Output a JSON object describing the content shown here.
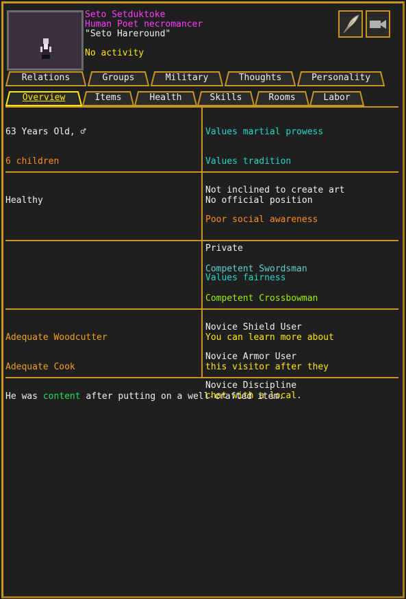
{
  "unit": {
    "name": "Seto Setduktoke",
    "profession": "Human Poet necromancer",
    "nickname": "\"Seto Hareround\"",
    "activity": "No activity"
  },
  "icons": {
    "quill": "quill-icon",
    "camera": "camera-icon"
  },
  "tabs_top": [
    "Relations",
    "Groups",
    "Military",
    "Thoughts",
    "Personality"
  ],
  "tabs_bottom": [
    "Overview",
    "Items",
    "Health",
    "Skills",
    "Rooms",
    "Labor"
  ],
  "active_tab": "Overview",
  "overview": {
    "age": "63 Years Old, ♂",
    "children": "6 children",
    "values": [
      {
        "text": "Values martial prowess",
        "color": "#22d8c8"
      },
      {
        "text": "Values tradition",
        "color": "#22d8c8"
      },
      {
        "text": "Not inclined to create art",
        "color": "#f0f0f0"
      },
      {
        "text": "Poor social awareness",
        "color": "#ff8c1e"
      },
      {
        "text": "Private",
        "color": "#f0f0f0"
      },
      {
        "text": "Values fairness",
        "color": "#22d8c8"
      }
    ],
    "health": "Healthy",
    "position": "No official position",
    "military_skills": [
      {
        "text": "Competent Swordsman",
        "color": "#60d0d0"
      },
      {
        "text": "Competent Crossbowman",
        "color": "#9cf000"
      },
      {
        "text": "Novice Shield User",
        "color": "#f0f0f0"
      },
      {
        "text": "Novice Armor User",
        "color": "#f0f0f0"
      },
      {
        "text": "Novice Discipline",
        "color": "#f0f0f0"
      }
    ],
    "labor_skills": [
      "Adequate Woodcutter",
      "Adequate Cook"
    ],
    "visitor_note": [
      "You can learn more about",
      "this visitor after they",
      "chat with a local."
    ]
  },
  "thought": {
    "before": "He was ",
    "emotion": "content",
    "after": " after putting on a well-crafted item."
  }
}
